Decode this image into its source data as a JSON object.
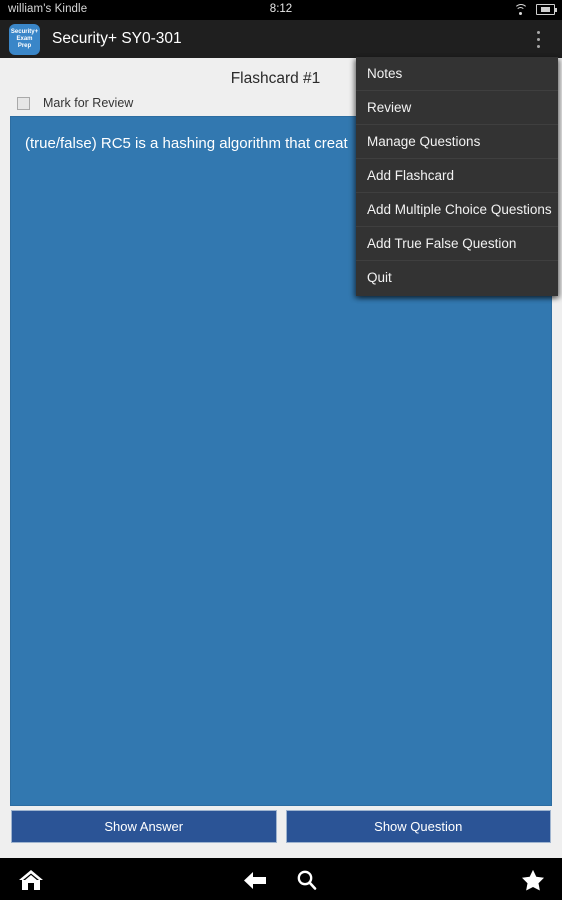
{
  "status_bar": {
    "device_name": "william's Kindle",
    "time": "8:12",
    "wifi_icon": "wifi-icon",
    "battery_icon": "battery-icon"
  },
  "action_bar": {
    "app_icon_line1": "Security+",
    "app_icon_line2": "Exam",
    "app_icon_line3": "Prep",
    "title": "Security+ SY0-301",
    "overflow_icon": "overflow-menu-icon"
  },
  "content": {
    "flashcard_title": "Flashcard #1",
    "mark_for_review_label": "Mark for Review",
    "mark_for_review_checked": false,
    "flashcard_text": "(true/false) RC5 is a hashing algorithm that creat",
    "show_answer_label": "Show Answer",
    "show_question_label": "Show Question"
  },
  "popup_menu": {
    "visible": true,
    "items": [
      {
        "label": "Notes"
      },
      {
        "label": "Review"
      },
      {
        "label": "Manage Questions"
      },
      {
        "label": "Add Flashcard"
      },
      {
        "label": "Add Multiple Choice Questions"
      },
      {
        "label": "Add True False Question"
      },
      {
        "label": "Quit"
      }
    ]
  },
  "nav_bar": {
    "home_icon": "home-icon",
    "back_icon": "back-arrow-icon",
    "search_icon": "search-icon",
    "star_icon": "star-icon"
  },
  "colors": {
    "flashcard_blue": "#3278b0",
    "button_blue": "#2b5496",
    "menu_background": "#333333",
    "action_bar": "#1f1f1f",
    "content_background": "#efefef",
    "app_icon_blue": "#3a86c8"
  }
}
